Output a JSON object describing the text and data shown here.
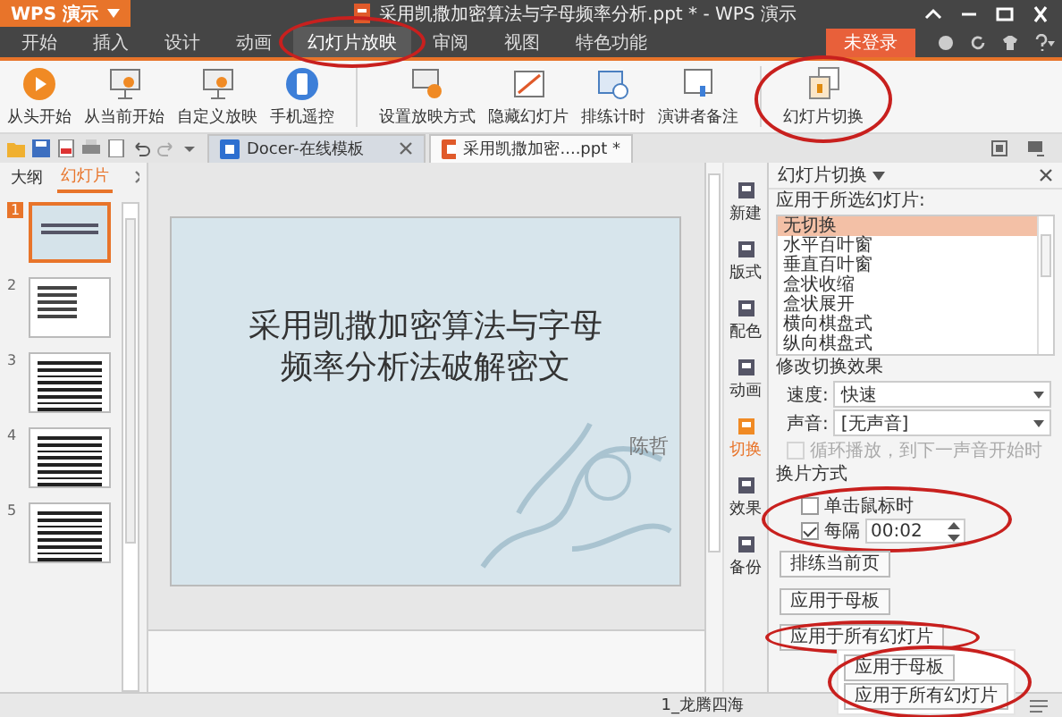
{
  "window": {
    "app_button": "WPS 演示",
    "title": "采用凯撒加密算法与字母频率分析.ppt * - WPS 演示"
  },
  "menu_tabs": [
    {
      "label": "开始",
      "selected": false,
      "circled": false
    },
    {
      "label": "插入",
      "selected": false,
      "circled": false
    },
    {
      "label": "设计",
      "selected": false,
      "circled": false
    },
    {
      "label": "动画",
      "selected": false,
      "circled": false
    },
    {
      "label": "幻灯片放映",
      "selected": true,
      "circled": true
    },
    {
      "label": "审阅",
      "selected": false,
      "circled": false
    },
    {
      "label": "视图",
      "selected": false,
      "circled": false
    },
    {
      "label": "特色功能",
      "selected": false,
      "circled": false
    }
  ],
  "login_button": "未登录",
  "ribbon_groups": [
    {
      "buttons": [
        {
          "label": "从头开始",
          "circled": false
        },
        {
          "label": "从当前开始",
          "circled": false
        },
        {
          "label": "自定义放映",
          "circled": false
        },
        {
          "label": "手机遥控",
          "circled": false
        }
      ]
    },
    {
      "buttons": [
        {
          "label": "设置放映方式",
          "circled": false
        },
        {
          "label": "隐藏幻灯片",
          "circled": false
        },
        {
          "label": "排练计时",
          "circled": false
        },
        {
          "label": "演讲者备注",
          "circled": false
        }
      ]
    },
    {
      "buttons": [
        {
          "label": "幻灯片切换",
          "circled": true
        }
      ]
    }
  ],
  "doc_tabs": [
    {
      "label": "Docer-在线模板",
      "selected": false,
      "closable": true
    },
    {
      "label": "采用凯撒加密....ppt *",
      "selected": true,
      "closable": false
    }
  ],
  "left_panel": {
    "tabs": [
      {
        "label": "大纲",
        "selected": false
      },
      {
        "label": "幻灯片",
        "selected": true
      }
    ],
    "thumbnails": [
      {
        "number": "1",
        "selected": true
      },
      {
        "number": "2",
        "selected": false
      },
      {
        "number": "3",
        "selected": false
      },
      {
        "number": "4",
        "selected": false
      },
      {
        "number": "5",
        "selected": false
      }
    ]
  },
  "slide": {
    "title_lines": [
      "采用凯撒加密算法与字母",
      "频率分析法破解密文"
    ],
    "author": "陈哲"
  },
  "tool_strip": [
    {
      "label": "新建",
      "selected": false
    },
    {
      "label": "版式",
      "selected": false
    },
    {
      "label": "配色",
      "selected": false
    },
    {
      "label": "动画",
      "selected": false
    },
    {
      "label": "切换",
      "selected": true
    },
    {
      "label": "效果",
      "selected": false
    },
    {
      "label": "备份",
      "selected": false
    }
  ],
  "task_pane": {
    "title": "幻灯片切换",
    "apply_label": "应用于所选幻灯片:",
    "transitions": [
      {
        "label": "无切换",
        "selected": true
      },
      {
        "label": "水平百叶窗",
        "selected": false
      },
      {
        "label": "垂直百叶窗",
        "selected": false
      },
      {
        "label": "盒状收缩",
        "selected": false
      },
      {
        "label": "盒状展开",
        "selected": false
      },
      {
        "label": "横向棋盘式",
        "selected": false
      },
      {
        "label": "纵向棋盘式",
        "selected": false
      }
    ],
    "modify_heading": "修改切换效果",
    "speed": {
      "label": "速度:",
      "value": "快速"
    },
    "sound": {
      "label": "声音:",
      "value": "[无声音]"
    },
    "loop": {
      "label": "循环播放，到下一声音开始时",
      "checked": false,
      "disabled": true
    },
    "advance_heading": "换片方式",
    "advance_circled": true,
    "on_click": {
      "label": "单击鼠标时",
      "checked": false
    },
    "every": {
      "label": "每隔",
      "checked": true,
      "value": "00:02"
    },
    "buttons": [
      {
        "label": "排练当前页",
        "circled": false
      },
      {
        "label": "应用于母板",
        "circled": false
      },
      {
        "label": "应用于所有幻灯片",
        "circled": true
      }
    ]
  },
  "magnified_inset": {
    "circled": true,
    "buttons": [
      "应用于母板",
      "应用于所有幻灯片"
    ]
  },
  "status_bar": {
    "design": "1_龙腾四海"
  }
}
